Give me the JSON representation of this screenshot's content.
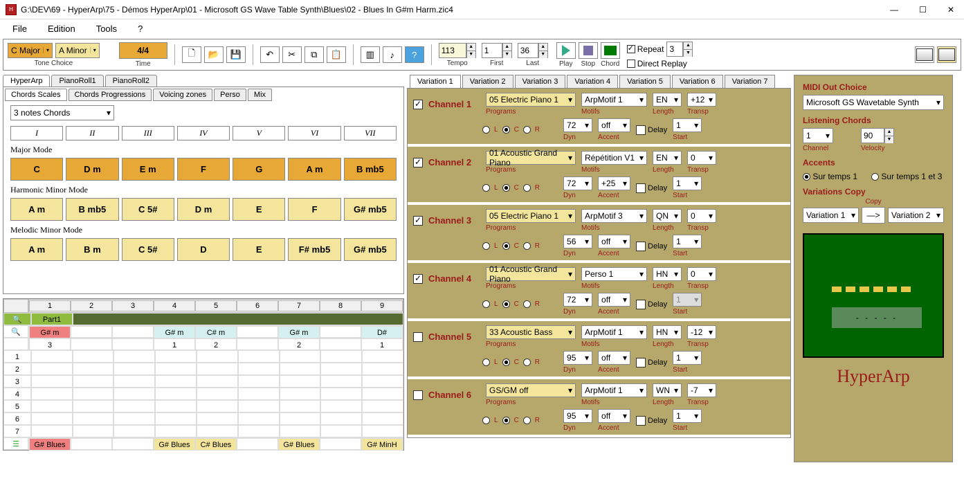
{
  "window": {
    "title": "G:\\DEV\\69 - HyperArp\\75 - Démos HyperArp\\01  - Microsoft GS Wave Table Synth\\Blues\\02 - Blues In G#m Harm.zic4"
  },
  "menu": {
    "file": "File",
    "edition": "Edition",
    "tools": "Tools",
    "help": "?"
  },
  "toolbar": {
    "tone1": "C Major",
    "tone2": "A Minor",
    "tone_label": "Tone Choice",
    "time": "4/4",
    "time_label": "Time",
    "tempo": "113",
    "tempo_label": "Tempo",
    "first": "1",
    "first_label": "First",
    "last": "36",
    "last_label": "Last",
    "play_label": "Play",
    "stop_label": "Stop",
    "chord_label": "Chord",
    "repeat": "Repeat",
    "repeat_n": "3",
    "direct": "Direct Replay"
  },
  "main_tabs": {
    "t1": "HyperArp",
    "t2": "PianoRoll1",
    "t3": "PianoRoll2"
  },
  "sub_tabs": {
    "s1": "Chords Scales",
    "s2": "Chords Progressions",
    "s3": "Voicing zones",
    "s4": "Perso",
    "s5": "Mix"
  },
  "scales": {
    "notes_sel": "3 notes Chords",
    "roman": [
      "I",
      "II",
      "III",
      "IV",
      "V",
      "VI",
      "VII"
    ],
    "major_label": "Major Mode",
    "major": [
      "C",
      "D m",
      "E m",
      "F",
      "G",
      "A m",
      "B mb5"
    ],
    "harm_label": "Harmonic Minor Mode",
    "harm": [
      "A m",
      "B mb5",
      "C 5#",
      "D m",
      "E",
      "F",
      "G# mb5"
    ],
    "mel_label": "Melodic Minor Mode",
    "mel": [
      "A m",
      "B m",
      "C 5#",
      "D",
      "E",
      "F# mb5",
      "G# mb5"
    ]
  },
  "grid": {
    "cols": [
      "1",
      "2",
      "3",
      "4",
      "5",
      "6",
      "7",
      "8",
      "9"
    ],
    "part": "Part1",
    "row_a": [
      "G# m",
      "",
      "",
      "G# m",
      "C# m",
      "",
      "G# m",
      "",
      "D#"
    ],
    "row_b": [
      "3",
      "",
      "",
      "1",
      "2",
      "",
      "2",
      "",
      "1"
    ],
    "nums": [
      "1",
      "2",
      "3",
      "4",
      "5",
      "6",
      "7"
    ],
    "row_c": [
      "G# Blues",
      "",
      "",
      "G# Blues",
      "C# Blues",
      "",
      "G# Blues",
      "",
      "G# MinH"
    ]
  },
  "var_tabs": [
    "Variation 1",
    "Variation 2",
    "Variation 3",
    "Variation 4",
    "Variation 5",
    "Variation 6",
    "Variation 7"
  ],
  "channels": [
    {
      "on": true,
      "name": "Channel 1",
      "prog": "05 Electric Piano 1",
      "motif": "ArpMotif 1",
      "len": "EN",
      "tr": "+12",
      "dyn": "72",
      "acc": "off",
      "delay": false,
      "start": "1",
      "start_en": true
    },
    {
      "on": true,
      "name": "Channel 2",
      "prog": "01 Acoustic Grand Piano",
      "motif": "Répétition V1",
      "len": "EN",
      "tr": "0",
      "dyn": "72",
      "acc": "+25",
      "delay": false,
      "start": "1",
      "start_en": true
    },
    {
      "on": true,
      "name": "Channel 3",
      "prog": "05 Electric Piano 1",
      "motif": "ArpMotif 3",
      "len": "QN",
      "tr": "0",
      "dyn": "56",
      "acc": "off",
      "delay": false,
      "start": "1",
      "start_en": true
    },
    {
      "on": true,
      "name": "Channel 4",
      "prog": "01 Acoustic Grand Piano",
      "motif": "Perso 1",
      "len": "HN",
      "tr": "0",
      "dyn": "72",
      "acc": "off",
      "delay": false,
      "start": "1",
      "start_en": false
    },
    {
      "on": false,
      "name": "Channel 5",
      "prog": "33 Acoustic Bass",
      "motif": "ArpMotif 1",
      "len": "HN",
      "tr": "-12",
      "dyn": "95",
      "acc": "off",
      "delay": false,
      "start": "1",
      "start_en": true
    },
    {
      "on": false,
      "name": "Channel 6",
      "prog": "GS/GM off",
      "motif": "ArpMotif 1",
      "len": "WN",
      "tr": "-7",
      "dyn": "95",
      "acc": "off",
      "delay": false,
      "start": "1",
      "start_en": true
    }
  ],
  "labels": {
    "programs": "Programs",
    "motifs": "Motifs",
    "length": "Length",
    "transp": "Transp",
    "dyn": "Dyn",
    "accent": "Accent",
    "delay": "Delay",
    "start": "Start",
    "l": "L",
    "c": "C",
    "r": "R"
  },
  "right": {
    "midi_title": "MIDI Out Choice",
    "midi": "Microsoft GS Wavetable Synth",
    "listen_title": "Listening Chords",
    "channel": "1",
    "channel_lbl": "Channel",
    "velocity": "90",
    "velocity_lbl": "Velocity",
    "accents_title": "Accents",
    "a1": "Sur temps 1",
    "a2": "Sur temps 1 et 3",
    "copy_title": "Variations Copy",
    "copy_lbl": "Copy",
    "arrow": "—>",
    "v1": "Variation 1",
    "v2": "Variation 2",
    "dashes": "- - - - -",
    "brand": "HyperArp"
  }
}
